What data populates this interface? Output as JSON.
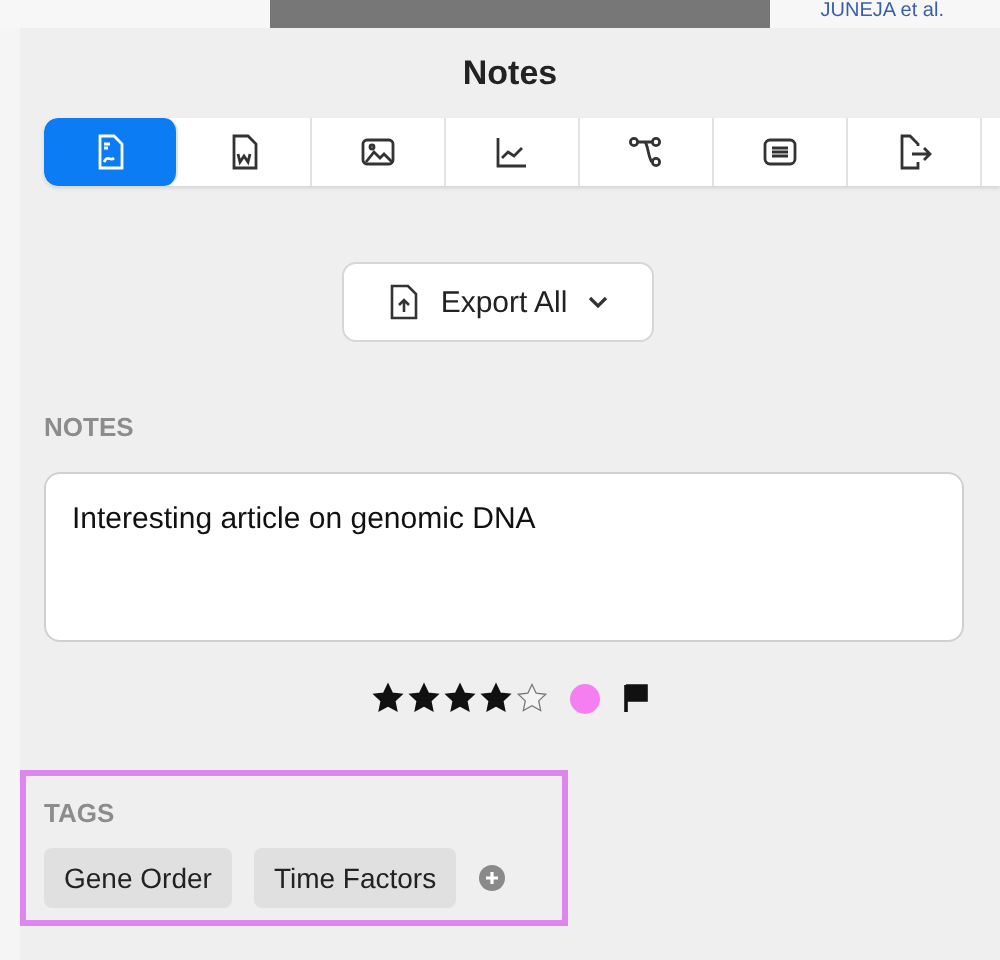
{
  "background_window": {
    "text": "JUNEJA et al."
  },
  "panel": {
    "title": "Notes"
  },
  "tabs": [
    {
      "kind": "pdf",
      "selected": true
    },
    {
      "kind": "word",
      "selected": false
    },
    {
      "kind": "image",
      "selected": false
    },
    {
      "kind": "chart",
      "selected": false
    },
    {
      "kind": "graph",
      "selected": false
    },
    {
      "kind": "list",
      "selected": false
    },
    {
      "kind": "export",
      "selected": false
    }
  ],
  "export_button": {
    "label": "Export All"
  },
  "notes": {
    "heading": "NOTES",
    "value": "Interesting article on genomic DNA"
  },
  "rating": {
    "stars": 4,
    "color": "#f57ef0",
    "flagged": true
  },
  "tags": {
    "heading": "TAGS",
    "items": [
      "Gene Order",
      "Time Factors"
    ]
  }
}
